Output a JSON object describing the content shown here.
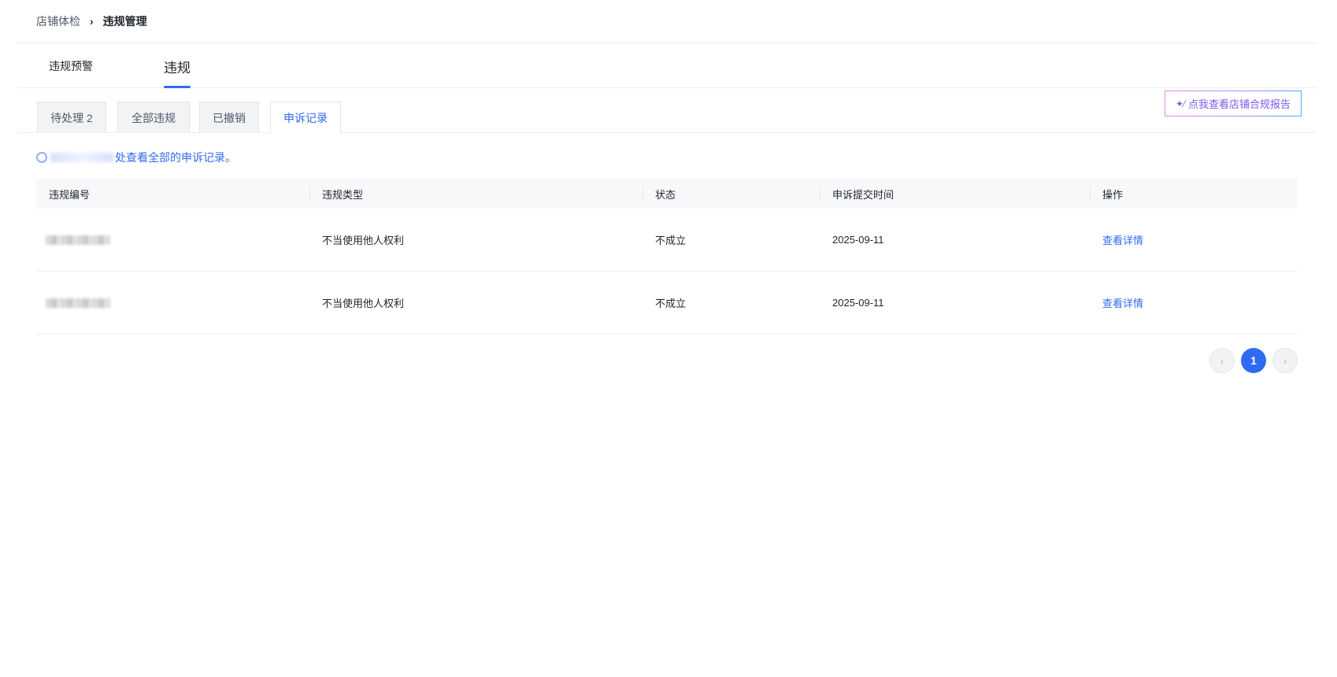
{
  "breadcrumb": {
    "parent": "店铺体检",
    "separator": "›",
    "current": "违规管理"
  },
  "main_tabs": [
    {
      "label": "违规预警"
    },
    {
      "label": "违规"
    }
  ],
  "report_button": {
    "icon": "sparkle-icon",
    "label": "点我查看店铺合规报告"
  },
  "sub_tabs": [
    {
      "label": "待处理 2"
    },
    {
      "label": "全部违规"
    },
    {
      "label": "已撤销"
    },
    {
      "label": "申诉记录"
    }
  ],
  "notice": {
    "text": "处查看全部的申诉记录。"
  },
  "table": {
    "headers": [
      "违规编号",
      "违规类型",
      "状态",
      "申诉提交时间",
      "操作"
    ],
    "rows": [
      {
        "type": "不当使用他人权利",
        "status": "不成立",
        "time": "2025-09-11",
        "action": "查看详情"
      },
      {
        "type": "不当使用他人权利",
        "status": "不成立",
        "time": "2025-09-11",
        "action": "查看详情"
      }
    ]
  },
  "pagination": {
    "prev": "‹",
    "current": "1",
    "next": "›"
  },
  "colors": {
    "accent": "#2f6bf2",
    "border": "#ebedf0",
    "header_bg": "#f7f8fa"
  }
}
